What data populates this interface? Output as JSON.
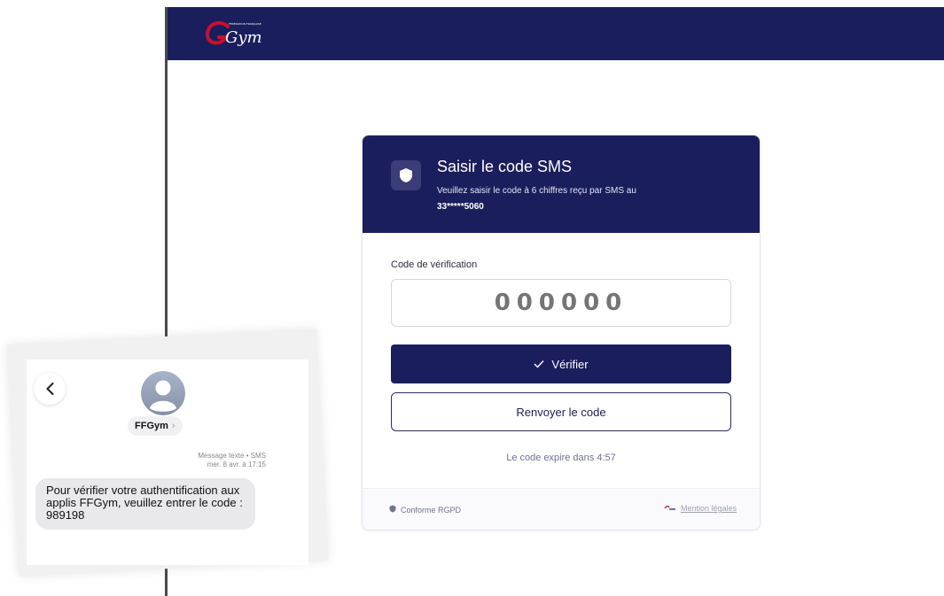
{
  "header": {
    "logo_icon": "ffgym-logo",
    "logo_text": "Gym",
    "logo_small_text": "FÉDÉRATION FRANÇAISE"
  },
  "card": {
    "header_icon": "shield-icon",
    "title": "Saisir le code SMS",
    "subtitle": "Veuillez saisir le code à 6 chiffres reçu par SMS au",
    "phone": "33*****5060",
    "field_label": "Code de vérification",
    "code_placeholder": "000000",
    "code_value": "",
    "verify_icon": "check-icon",
    "verify_label": "Vérifier",
    "resend_label": "Renvoyer le code",
    "expire_text": "Le code expire dans 4:57",
    "rgpd_icon": "shield-icon",
    "rgpd_label": "Conforme RGPD",
    "mentions_icon": "ffgym-logo",
    "mentions_label": "Mention légales"
  },
  "sms": {
    "back_icon": "chevron-left-icon",
    "avatar_icon": "person-icon",
    "contact_name": "FFGym",
    "contact_chevron": "›",
    "meta_type": "Message texte • SMS",
    "meta_date": "mer. 8 avr. à 17:15",
    "message": "Pour vérifier votre authentification aux applis FFGym, veuillez entrer le code : 989198"
  },
  "colors": {
    "navy": "#1b1e5c",
    "bubble_gray": "#e9e9eb",
    "logo_red": "#c8102e"
  }
}
